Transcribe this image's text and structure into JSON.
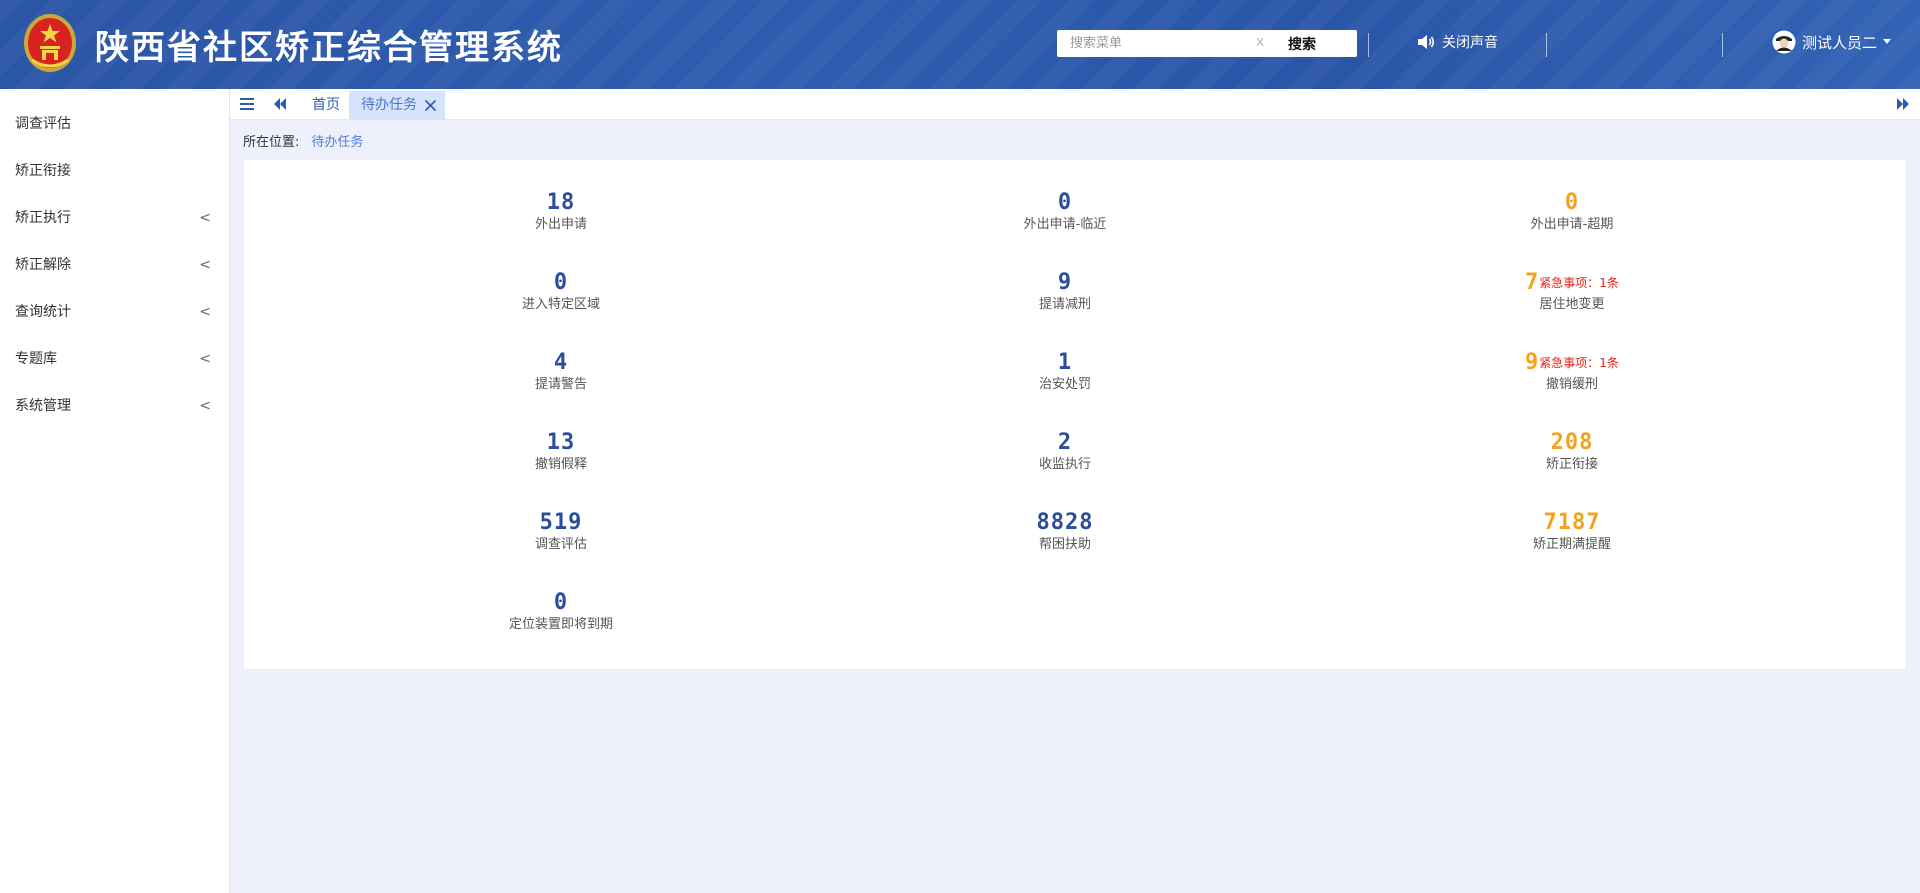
{
  "header": {
    "title": "陕西省社区矫正综合管理系统",
    "search_placeholder": "搜索菜单",
    "search_clear": "x",
    "search_button": "搜索",
    "sound_label": "关闭声音",
    "user_name": "测试人员二"
  },
  "sidebar": {
    "items": [
      {
        "label": "调查评估",
        "has_children": false
      },
      {
        "label": "矫正衔接",
        "has_children": false
      },
      {
        "label": "矫正执行",
        "has_children": true
      },
      {
        "label": "矫正解除",
        "has_children": true
      },
      {
        "label": "查询统计",
        "has_children": true
      },
      {
        "label": "专题库",
        "has_children": true
      },
      {
        "label": "系统管理",
        "has_children": true
      }
    ]
  },
  "tabs": [
    {
      "label": "首页",
      "active": false
    },
    {
      "label": "待办任务",
      "active": true
    }
  ],
  "breadcrumb": {
    "prefix": "所在位置:",
    "current": "待办任务"
  },
  "stats": [
    {
      "value": "18",
      "label": "外出申请",
      "color": "blue"
    },
    {
      "value": "0",
      "label": "外出申请-临近",
      "color": "blue"
    },
    {
      "value": "0",
      "label": "外出申请-超期",
      "color": "orange"
    },
    {
      "value": "0",
      "label": "进入特定区域",
      "color": "blue"
    },
    {
      "value": "9",
      "label": "提请减刑",
      "color": "blue"
    },
    {
      "value": "7",
      "label": "居住地变更",
      "color": "orange",
      "urgent": "紧急事项：1条"
    },
    {
      "value": "4",
      "label": "提请警告",
      "color": "blue"
    },
    {
      "value": "1",
      "label": "治安处罚",
      "color": "blue"
    },
    {
      "value": "9",
      "label": "撤销缓刑",
      "color": "orange",
      "urgent": "紧急事项：1条"
    },
    {
      "value": "13",
      "label": "撤销假释",
      "color": "blue"
    },
    {
      "value": "2",
      "label": "收监执行",
      "color": "blue"
    },
    {
      "value": "208",
      "label": "矫正衔接",
      "color": "orange"
    },
    {
      "value": "519",
      "label": "调查评估",
      "color": "blue"
    },
    {
      "value": "8828",
      "label": "帮困扶助",
      "color": "blue"
    },
    {
      "value": "7187",
      "label": "矫正期满提醒",
      "color": "orange"
    },
    {
      "value": "0",
      "label": "定位装置即将到期",
      "color": "blue"
    }
  ],
  "colors": {
    "header_bg": "#2f5cb0",
    "number_blue": "#2a4d9c",
    "number_orange": "#f2a31b",
    "urgent_red": "#e8221a",
    "active_tab_bg": "#d6e4fb"
  }
}
